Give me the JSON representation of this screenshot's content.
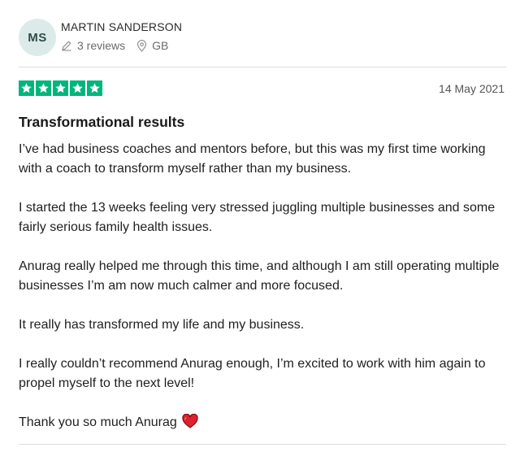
{
  "reviewer": {
    "initials": "MS",
    "name": "MARTIN SANDERSON",
    "reviews_count": "3 reviews",
    "country": "GB"
  },
  "rating": {
    "stars": 5,
    "max": 5,
    "color": "#00b67a"
  },
  "date": "14 May 2021",
  "title": "Transformational results",
  "paragraphs": [
    "I’ve had business coaches and mentors before, but this was my first time working with a coach to transform myself rather than my business.",
    "I started the 13 weeks feeling very stressed juggling multiple businesses and some fairly serious family health issues.",
    "Anurag really helped me through this time, and although I am still operating multiple businesses I’m am now much calmer and more focused.",
    "It really has transformed my life and my business.",
    "I really couldn’t recommend Anurag enough, I’m excited to work with him again to propel myself to the next level!",
    "Thank you so much Anurag"
  ],
  "icons": {
    "reviews": "pencil-icon",
    "country": "location-pin-icon",
    "emoji": "red-heart-icon",
    "star": "star-icon"
  }
}
